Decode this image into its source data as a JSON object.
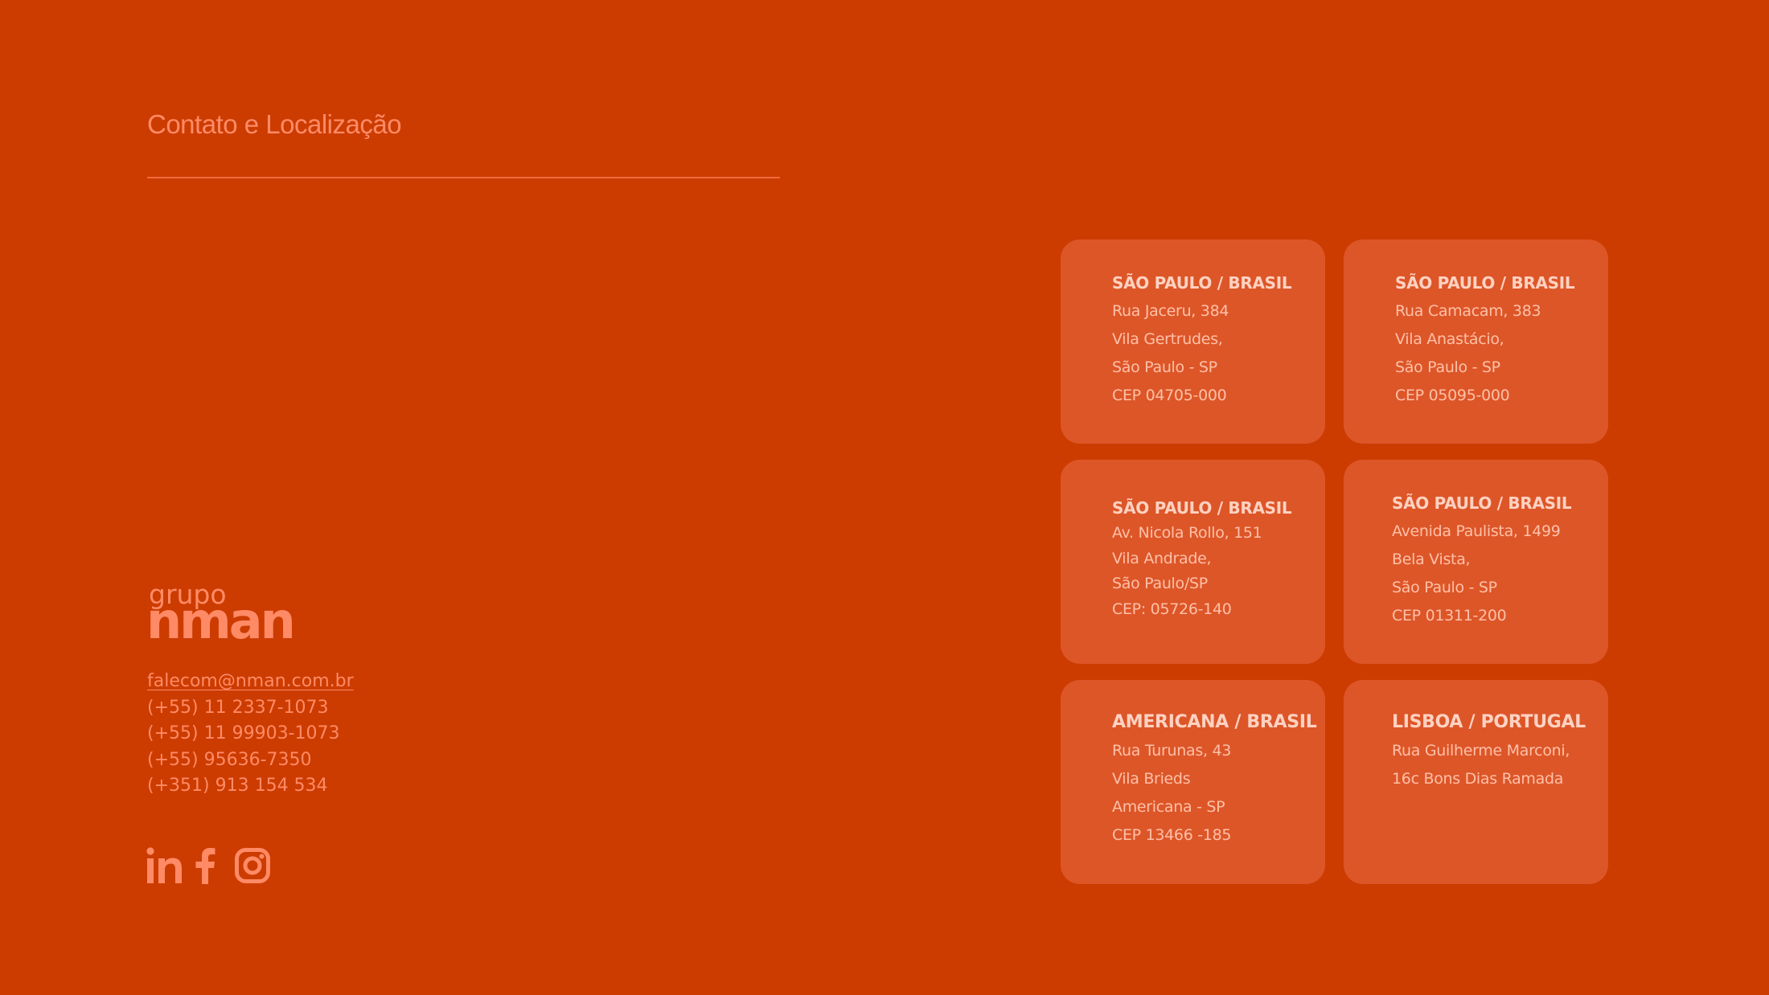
{
  "page": {
    "title": "Contato e Localização"
  },
  "brand": {
    "logo_top": "grupo",
    "logo_main": "nman"
  },
  "contacts": {
    "email": "falecom@nman.com.br",
    "phones": [
      "(+55) 11 2337-1073",
      "(+55) 11 99903-1073",
      "(+55) 95636-7350",
      "(+351) 913 154 534"
    ]
  },
  "social": {
    "icons": [
      "linkedin-icon",
      "facebook-icon",
      "instagram-icon"
    ]
  },
  "locations": [
    {
      "city": "SÃO PAULO / BRASIL",
      "lines": [
        "Rua Jaceru, 384",
        "Vila Gertrudes,",
        "São Paulo - SP",
        "CEP 04705-000"
      ]
    },
    {
      "city": "SÃO PAULO / BRASIL",
      "lines": [
        "Rua Camacam, 383",
        "Vila Anastácio,",
        "São Paulo - SP",
        "CEP 05095-000"
      ]
    },
    {
      "city": "SÃO PAULO / BRASIL",
      "lines": [
        "Av. Nicola Rollo, 151",
        "Vila Andrade,",
        "São Paulo/SP",
        "CEP: 05726-140"
      ]
    },
    {
      "city": "SÃO PAULO / BRASIL",
      "lines": [
        "Avenida Paulista, 1499",
        "Bela Vista,",
        "São Paulo - SP",
        "CEP 01311-200"
      ]
    },
    {
      "city": "AMERICANA / BRASIL",
      "lines": [
        "Rua Turunas, 43",
        "Vila Brieds",
        "Americana - SP",
        "CEP 13466 -185"
      ]
    },
    {
      "city": "LISBOA / PORTUGAL",
      "lines": [
        "Rua Guilherme Marconi,",
        "16c Bons Dias Ramada"
      ]
    }
  ],
  "colors": {
    "background": "#cc3c00",
    "card": "#dd5628",
    "accent": "#ff8a66"
  }
}
